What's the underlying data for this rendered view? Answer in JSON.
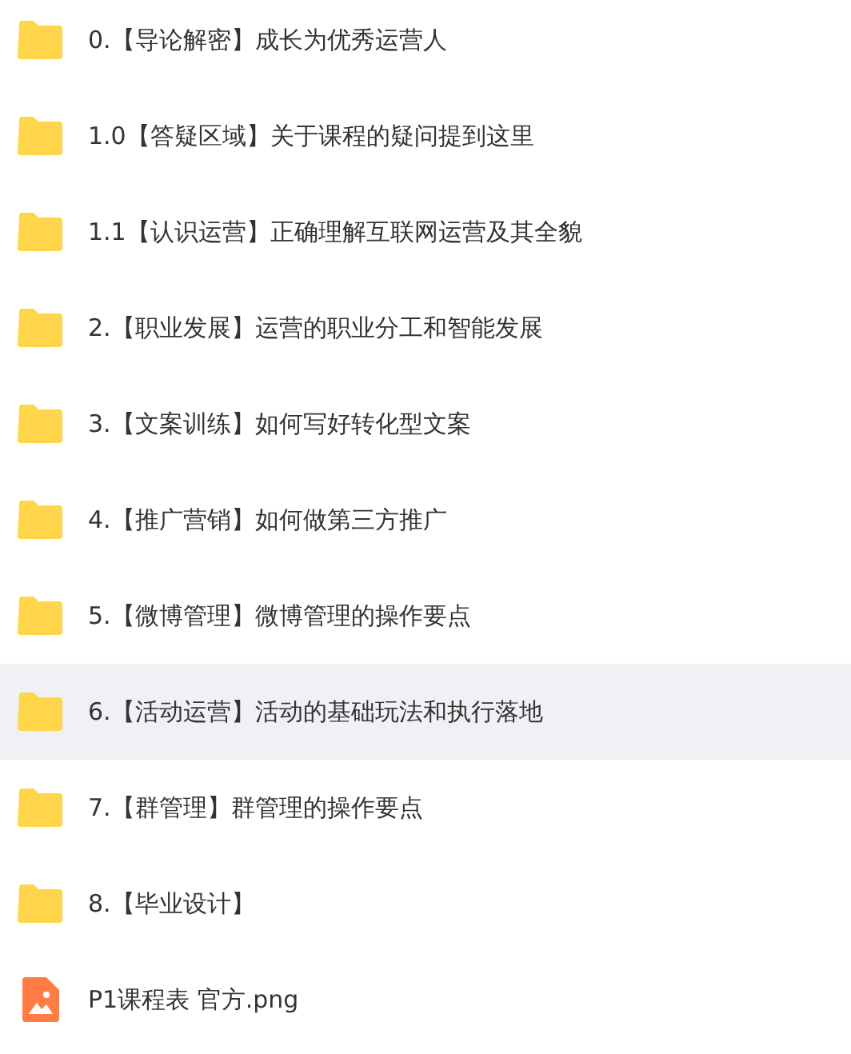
{
  "files": [
    {
      "kind": "folder",
      "name": "0.【导论解密】成长为优秀运营人",
      "highlighted": false
    },
    {
      "kind": "folder",
      "name": "1.0【答疑区域】关于课程的疑问提到这里",
      "highlighted": false
    },
    {
      "kind": "folder",
      "name": "1.1【认识运营】正确理解互联网运营及其全貌",
      "highlighted": false
    },
    {
      "kind": "folder",
      "name": "2.【职业发展】运营的职业分工和智能发展",
      "highlighted": false
    },
    {
      "kind": "folder",
      "name": "3.【文案训练】如何写好转化型文案",
      "highlighted": false
    },
    {
      "kind": "folder",
      "name": "4.【推广营销】如何做第三方推广",
      "highlighted": false
    },
    {
      "kind": "folder",
      "name": "5.【微博管理】微博管理的操作要点",
      "highlighted": false
    },
    {
      "kind": "folder",
      "name": "6.【活动运营】活动的基础玩法和执行落地",
      "highlighted": true
    },
    {
      "kind": "folder",
      "name": "7.【群管理】群管理的操作要点",
      "highlighted": false
    },
    {
      "kind": "folder",
      "name": "8.【毕业设计】",
      "highlighted": false
    },
    {
      "kind": "image",
      "name": "P1课程表 官方.png",
      "highlighted": false
    }
  ]
}
